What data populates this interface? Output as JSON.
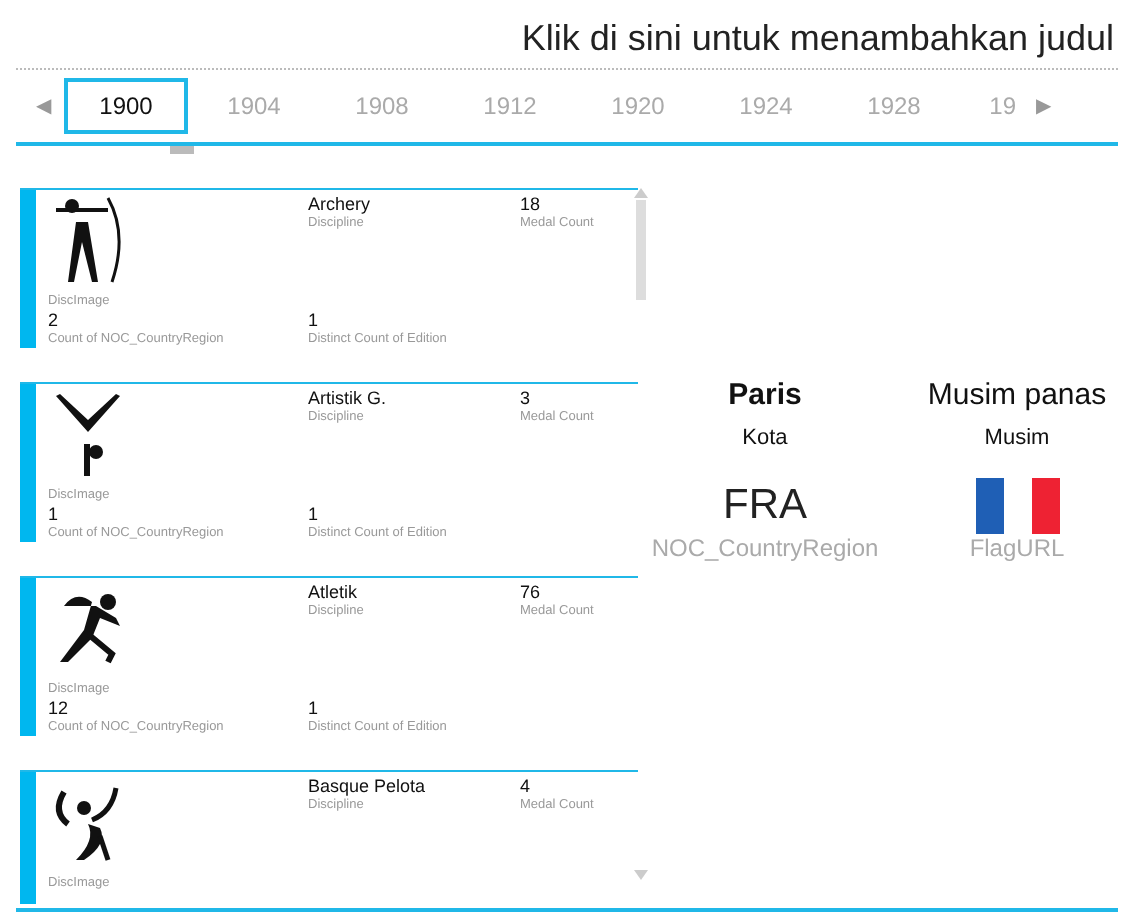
{
  "title": "Klik di sini untuk menambahkan judul",
  "timeline": {
    "prev": "◀",
    "next": "▶",
    "years": [
      {
        "label": "1900",
        "selected": true
      },
      {
        "label": "1904",
        "selected": false
      },
      {
        "label": "1908",
        "selected": false
      },
      {
        "label": "1912",
        "selected": false
      },
      {
        "label": "1920",
        "selected": false
      },
      {
        "label": "1924",
        "selected": false
      },
      {
        "label": "1928",
        "selected": false
      },
      {
        "label": "19",
        "selected": false
      }
    ]
  },
  "cards": [
    {
      "image_label": "DiscImage",
      "discipline": "Archery",
      "discipline_label": "Discipline",
      "medal_count": "18",
      "medal_label": "Medal Count",
      "country_count": "2",
      "country_label": "Count of NOC_CountryRegion",
      "edition_count": "1",
      "edition_label": "Distinct Count of Edition"
    },
    {
      "image_label": "DiscImage",
      "discipline": "Artistik G.",
      "discipline_label": "Discipline",
      "medal_count": "3",
      "medal_label": "Medal Count",
      "country_count": "1",
      "country_label": "Count of NOC_CountryRegion",
      "edition_count": "1",
      "edition_label": "Distinct Count of Edition"
    },
    {
      "image_label": "DiscImage",
      "discipline": "Atletik",
      "discipline_label": "Discipline",
      "medal_count": "76",
      "medal_label": "Medal Count",
      "country_count": "12",
      "country_label": "Count of NOC_CountryRegion",
      "edition_count": "1",
      "edition_label": "Distinct Count of Edition"
    },
    {
      "image_label": "DiscImage",
      "discipline": "Basque Pelota",
      "discipline_label": "Discipline",
      "medal_count": "4",
      "medal_label": "Medal Count"
    }
  ],
  "details": {
    "city": "Paris",
    "city_label": "Kota",
    "season": "Musim panas",
    "season_label": "Musim",
    "noc": "FRA",
    "noc_label": "NOC_CountryRegion",
    "flag_label": "FlagURL"
  }
}
